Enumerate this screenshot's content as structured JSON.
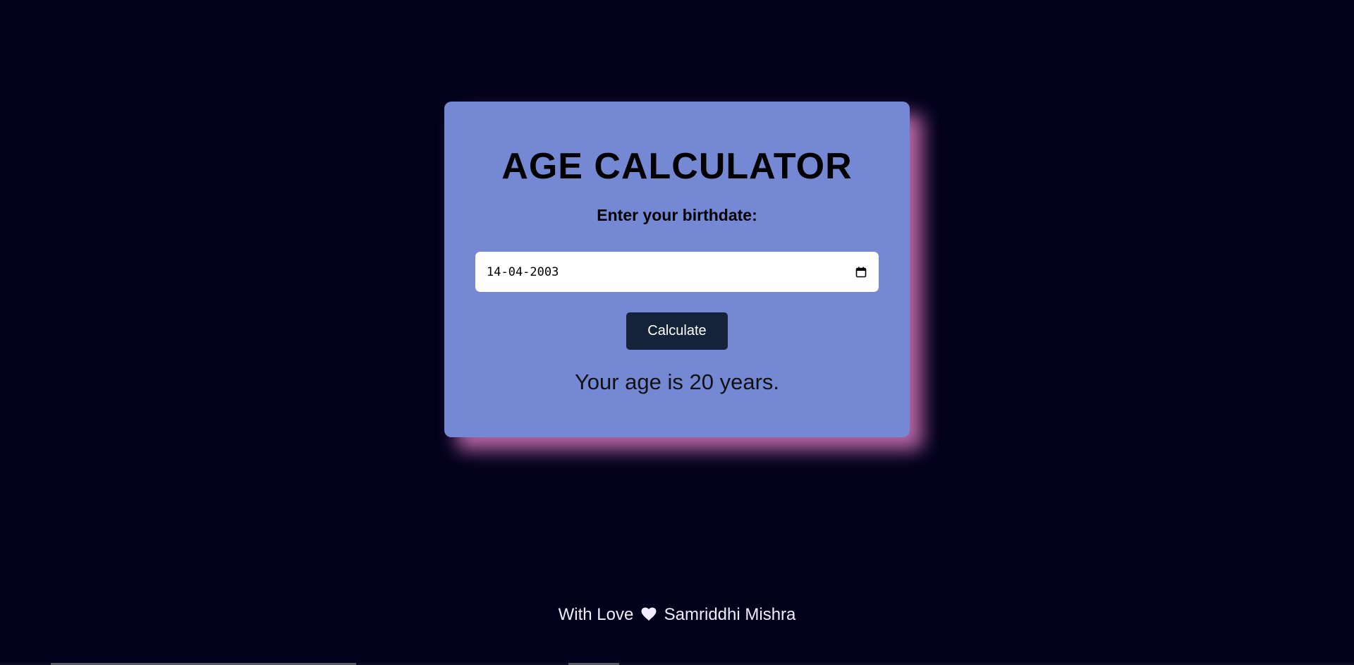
{
  "app": {
    "title": "AGE CALCULATOR",
    "birthdate_label": "Enter your birthdate:",
    "birthdate_value": "14-04-2003",
    "calculate_label": "Calculate",
    "result_text": "Your age is 20 years."
  },
  "footer": {
    "prefix": "With Love",
    "author": "Samriddhi Mishra",
    "heart_icon": "heart-icon"
  },
  "colors": {
    "background": "#03001c",
    "card": "#7488d4",
    "card_glow": "#d678be",
    "button": "#14233a",
    "footer_text": "#f2ecff"
  }
}
